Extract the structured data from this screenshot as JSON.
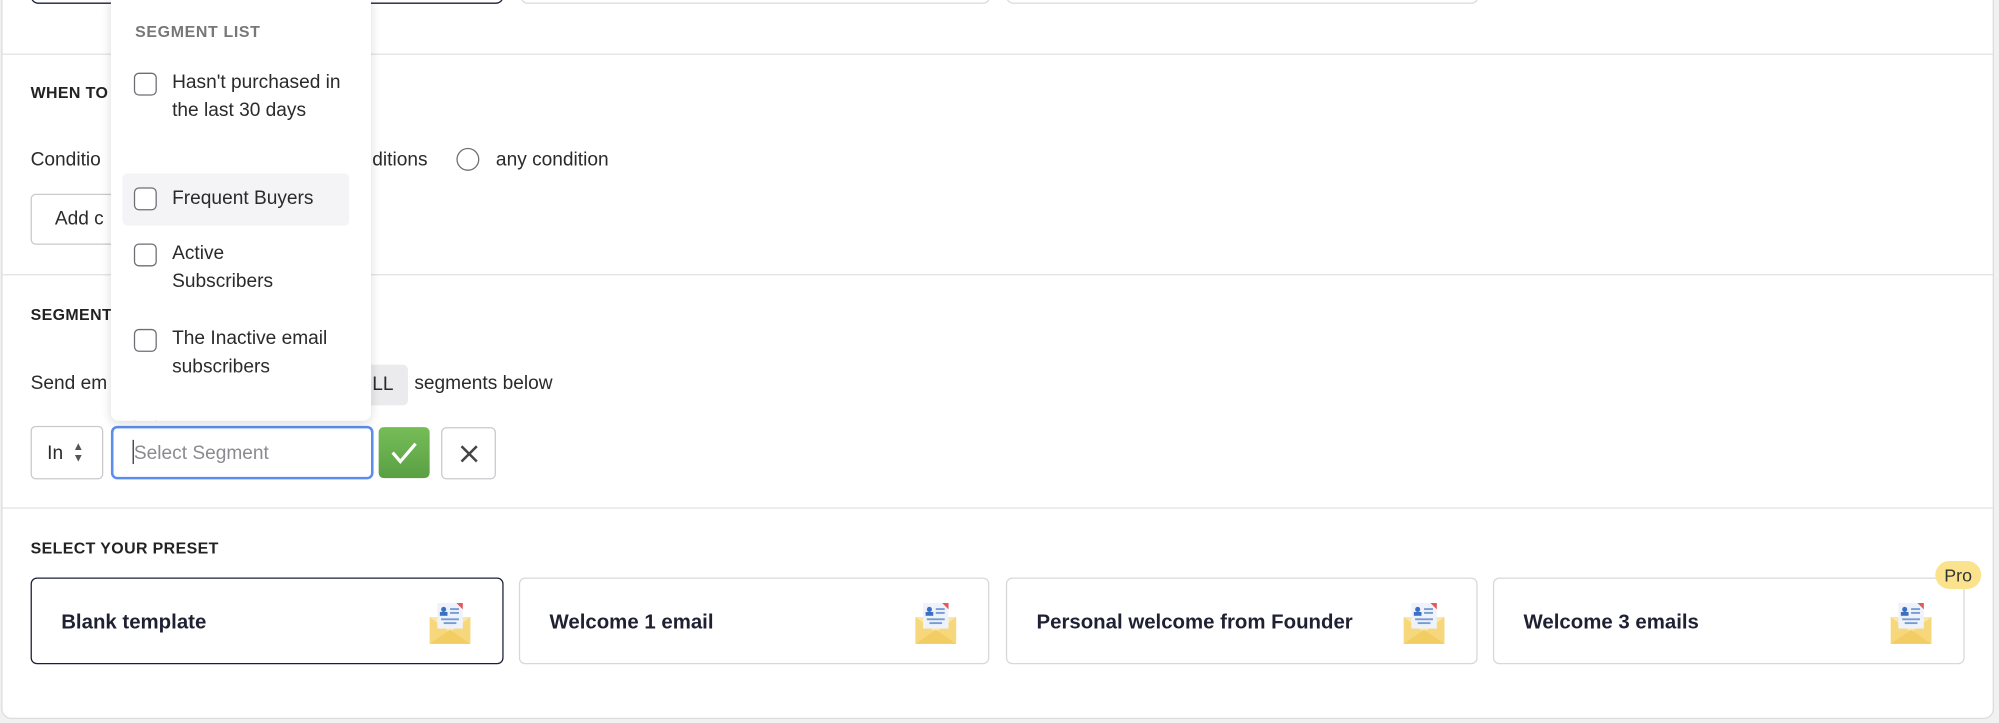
{
  "sections": {
    "when_to_send": {
      "label_visible": "WHEN TO",
      "conditions_prefix": "Conditio",
      "conditions_suffix": "ditions",
      "any_condition": "any condition",
      "add_button": "Add c"
    },
    "segment": {
      "label_visible": "SEGMENT",
      "send_prefix": "Send em",
      "all_chip": "LL",
      "send_suffix": "segments below",
      "operator": "In",
      "input_placeholder": "Select Segment",
      "confirm": "confirm",
      "cancel": "cancel"
    },
    "preset": {
      "label": "SELECT YOUR PRESET",
      "cards": [
        {
          "name": "Blank template",
          "selected": true,
          "icon": "email-letter-icon"
        },
        {
          "name": "Welcome 1 email",
          "selected": false,
          "icon": "email-letter-icon"
        },
        {
          "name": "Personal welcome from Founder",
          "selected": false,
          "icon": "email-letter-icon"
        },
        {
          "name": "Welcome 3 emails",
          "selected": false,
          "icon": "email-letter-icon",
          "badge": "Pro"
        }
      ]
    }
  },
  "dropdown": {
    "header": "SEGMENT LIST",
    "items": [
      {
        "label": "Hasn't purchased in the last 30 days",
        "checked": false
      },
      {
        "label": "Frequent Buyers",
        "checked": false,
        "hovered": true
      },
      {
        "label": "Active Subscribers",
        "checked": false
      },
      {
        "label": "The Inactive email subscribers",
        "checked": false
      }
    ]
  },
  "colors": {
    "accent_dark": "#1b1f3a",
    "confirm_green": "#6ab04c",
    "focus_blue": "#5b8def",
    "pro_badge": "#fbe38e"
  }
}
